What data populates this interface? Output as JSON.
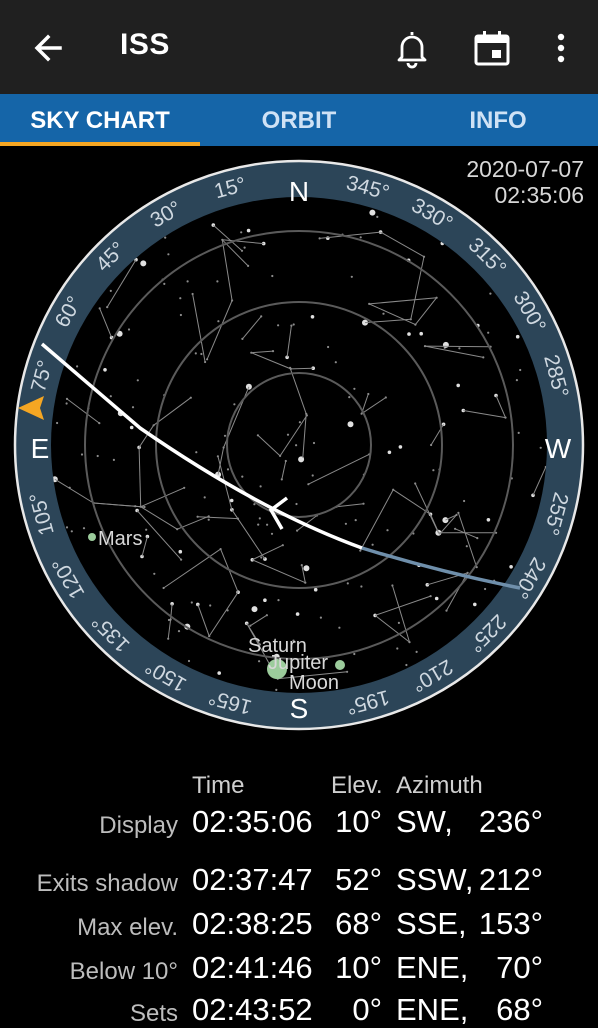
{
  "app_bar": {
    "title": "ISS"
  },
  "tabs": [
    {
      "label": "SKY CHART",
      "active": true
    },
    {
      "label": "ORBIT",
      "active": false
    },
    {
      "label": "INFO",
      "active": false
    }
  ],
  "sky_chart": {
    "date": "2020-07-07",
    "time": "02:35:06",
    "compass": {
      "north": "N",
      "south": "S",
      "east": "E",
      "west": "W"
    },
    "azimuth_ticks": [
      "15°",
      "30°",
      "45°",
      "60°",
      "75°",
      "105°",
      "120°",
      "135°",
      "150°",
      "165°",
      "195°",
      "210°",
      "225°",
      "240°",
      "255°",
      "285°",
      "300°",
      "315°",
      "330°",
      "345°"
    ],
    "objects": [
      "Mars",
      "Saturn",
      "Jupiter",
      "Moon"
    ],
    "colors": {
      "ring": "#2c4558",
      "path_visible": "#ffffff",
      "path_shadow": "#6f8fab",
      "marker": "#f5a623",
      "planet": "#9ccc9c"
    }
  },
  "pass_table": {
    "headers": {
      "time": "Time",
      "elev": "Elev.",
      "azimuth": "Azimuth"
    },
    "rows": [
      {
        "label": "Display",
        "time": "02:35:06",
        "elev": "10°",
        "dir": "SW,",
        "az": "236°"
      },
      {
        "label": "Exits shadow",
        "time": "02:37:47",
        "elev": "52°",
        "dir": "SSW,",
        "az": "212°"
      },
      {
        "label": "Max elev.",
        "time": "02:38:25",
        "elev": "68°",
        "dir": "SSE,",
        "az": "153°"
      },
      {
        "label": "Below 10°",
        "time": "02:41:46",
        "elev": "10°",
        "dir": "ENE,",
        "az": "70°"
      },
      {
        "label": "Sets",
        "time": "02:43:52",
        "elev": "0°",
        "dir": "ENE,",
        "az": "68°"
      }
    ]
  }
}
